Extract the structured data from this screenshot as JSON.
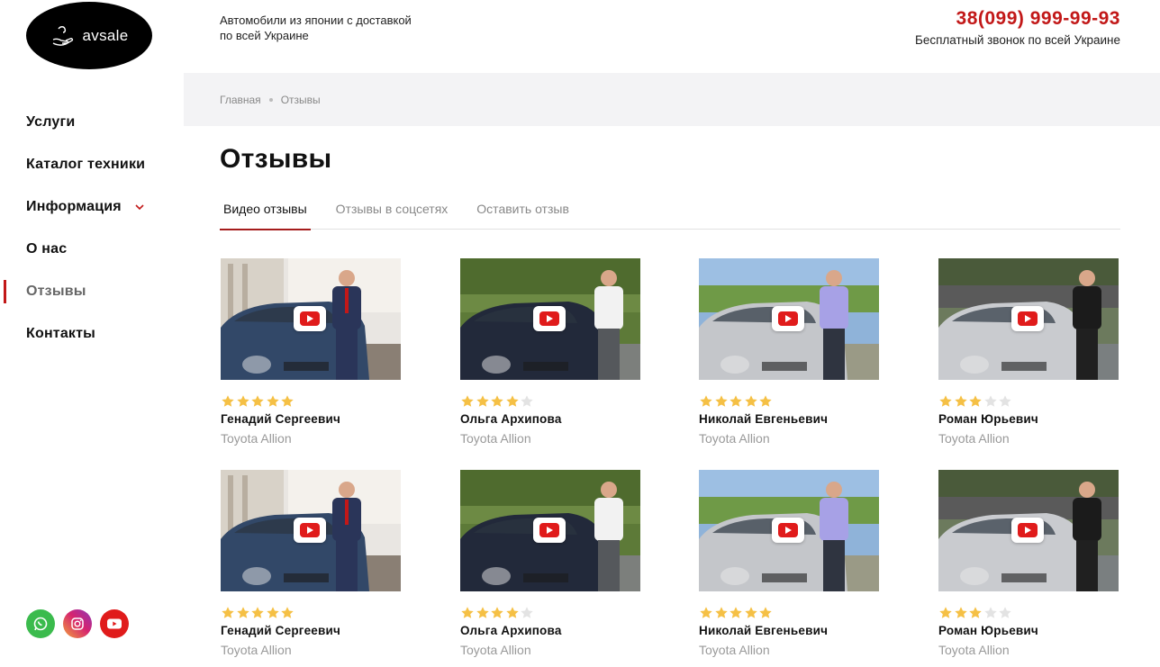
{
  "brand": {
    "name": "avsale"
  },
  "header": {
    "tagline": "Автомобили из японии с доставкой по всей Украине",
    "phone": "38(099) 999-99-93",
    "phone_note": "Бесплатный звонок по всей Украине"
  },
  "nav": {
    "items": [
      {
        "label": "Услуги"
      },
      {
        "label": "Каталог техники"
      },
      {
        "label": "Информация"
      },
      {
        "label": "О нас"
      },
      {
        "label": "Отзывы"
      },
      {
        "label": "Контакты"
      }
    ]
  },
  "breadcrumb": {
    "home": "Главная",
    "current": "Отзывы"
  },
  "page": {
    "title": "Отзывы"
  },
  "tabs": [
    {
      "label": "Видео отзывы",
      "active": true
    },
    {
      "label": "Отзывы в соцсетях",
      "active": false
    },
    {
      "label": "Оставить отзыв",
      "active": false
    }
  ],
  "reviews": [
    {
      "name": "Генадий Сергеевич",
      "model": "Toyota Allion",
      "rating": 5
    },
    {
      "name": "Ольга Архипова",
      "model": "Toyota Allion",
      "rating": 4
    },
    {
      "name": "Николай Евгеньевич",
      "model": "Toyota Allion",
      "rating": 5
    },
    {
      "name": "Роман Юрьевич",
      "model": "Toyota Allion",
      "rating": 3
    },
    {
      "name": "Генадий Сергеевич",
      "model": "Toyota Allion",
      "rating": 5
    },
    {
      "name": "Ольга Архипова",
      "model": "Toyota Allion",
      "rating": 4
    },
    {
      "name": "Николай Евгеньевич",
      "model": "Toyota Allion",
      "rating": 5
    },
    {
      "name": "Роман Юрьевич",
      "model": "Toyota Allion",
      "rating": 3
    }
  ],
  "colors": {
    "accent": "#c21818",
    "star_on": "#f5c045",
    "star_off": "#e3e3e3"
  },
  "socials": [
    "whatsapp-icon",
    "instagram-icon",
    "youtube-icon"
  ]
}
